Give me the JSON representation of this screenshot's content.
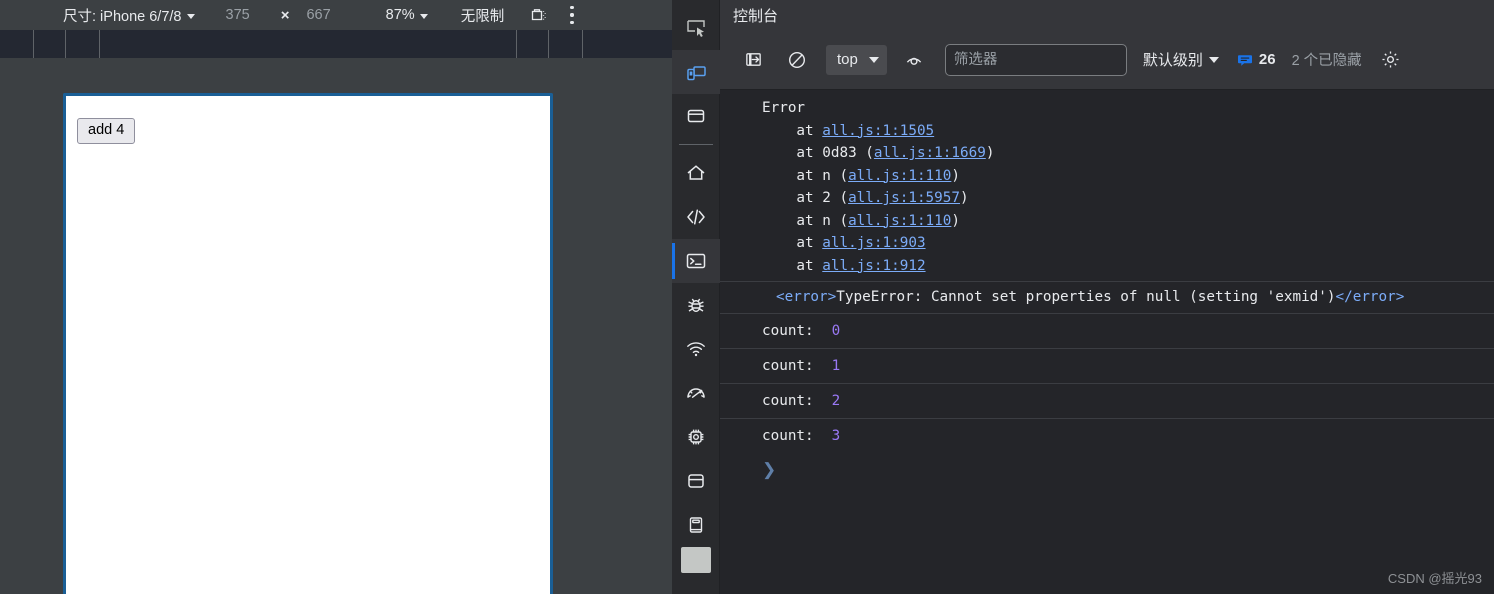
{
  "device_toolbar": {
    "size_label": "尺寸: iPhone 6/7/8",
    "width": "375",
    "times": "×",
    "height": "667",
    "zoom": "87%",
    "throttle": "无限制",
    "capture_icon": "screenshot-camera-icon",
    "more_icon": "more-vertical-icon"
  },
  "device_page": {
    "button_label": "add 4",
    "frame_border_color": "#1a5f96",
    "background": "#ffffff"
  },
  "icon_rail": {
    "items": [
      {
        "name": "inspect-element-icon",
        "active": false
      },
      {
        "name": "device-toolbar-icon",
        "active": true
      },
      {
        "name": "panel-layout-icon",
        "active": false
      },
      {
        "name": "home-icon",
        "active": false
      },
      {
        "name": "sources-code-icon",
        "active": false
      },
      {
        "name": "console-terminal-icon",
        "active": true
      },
      {
        "name": "bug-debug-icon",
        "active": false
      },
      {
        "name": "network-wifi-icon",
        "active": false
      },
      {
        "name": "performance-gauge-icon",
        "active": false
      },
      {
        "name": "memory-chip-icon",
        "active": false
      },
      {
        "name": "application-storage-icon",
        "active": false
      },
      {
        "name": "docs-book-icon",
        "active": false
      }
    ]
  },
  "console": {
    "title": "控制台",
    "toolbar": {
      "sidebar_toggle_icon": "show-console-sidebar-icon",
      "clear_icon": "clear-console-icon",
      "context_value": "top",
      "eye_icon": "live-expression-eye-icon",
      "filter_placeholder": "筛选器",
      "filter_value": "",
      "level_label": "默认级别",
      "message_badge_icon": "speech-bubble-icon",
      "message_count": "26",
      "message_badge_color": "#1a73e8",
      "hidden_label": "2 个已隐藏",
      "settings_icon": "gear-icon"
    },
    "error_block": {
      "header": "Error",
      "frames": [
        {
          "prefix": "    at ",
          "fn": "",
          "open": "",
          "link": "all.js:1:1505",
          "close": ""
        },
        {
          "prefix": "    at ",
          "fn": "0d83 ",
          "open": "(",
          "link": "all.js:1:1669",
          "close": ")"
        },
        {
          "prefix": "    at ",
          "fn": "n ",
          "open": "(",
          "link": "all.js:1:110",
          "close": ")"
        },
        {
          "prefix": "    at ",
          "fn": "2 ",
          "open": "(",
          "link": "all.js:1:5957",
          "close": ")"
        },
        {
          "prefix": "    at ",
          "fn": "n ",
          "open": "(",
          "link": "all.js:1:110",
          "close": ")"
        },
        {
          "prefix": "    at ",
          "fn": "",
          "open": "",
          "link": "all.js:1:903",
          "close": ""
        },
        {
          "prefix": "    at ",
          "fn": "",
          "open": "",
          "link": "all.js:1:912",
          "close": ""
        }
      ]
    },
    "error_xml": {
      "open_tag": "<error>",
      "text": "TypeError: Cannot set properties of null (setting 'exmid')",
      "close_tag": "</error>"
    },
    "count_rows": [
      {
        "label": "count:",
        "value": "0"
      },
      {
        "label": "count:",
        "value": "1"
      },
      {
        "label": "count:",
        "value": "2"
      },
      {
        "label": "count:",
        "value": "3"
      }
    ],
    "prompt_symbol": "❯"
  },
  "watermark": "CSDN @摇光93"
}
